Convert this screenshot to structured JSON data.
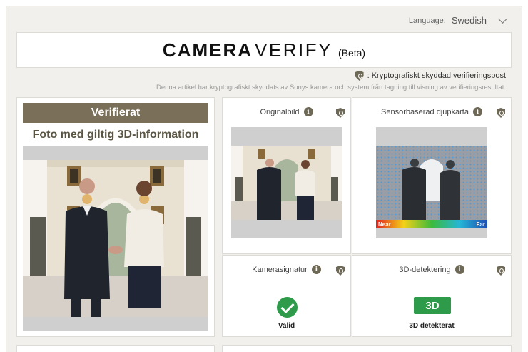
{
  "language": {
    "label": "Language:",
    "value": "Swedish"
  },
  "logo": {
    "bold": "CAMERA",
    "thin": "VERIFY",
    "suffix": "(Beta)"
  },
  "legend_text": ": Kryptografiskt skyddad verifieringspost",
  "description": "Denna artikel har kryptografiskt skyddats av Sonys kamera och system från tagning till visning av verifieringsresultat.",
  "main": {
    "status": "Verifierat",
    "subtitle": "Foto med giltig 3D-information"
  },
  "panels": {
    "original": {
      "title": "Originalbild"
    },
    "depth": {
      "title": "Sensorbaserad djupkarta",
      "near": "Near",
      "far": "Far"
    },
    "signature": {
      "title": "Kamerasignatur",
      "result": "Valid"
    },
    "detection": {
      "title": "3D-detektering",
      "badge": "3D",
      "result": "3D detekterat"
    }
  },
  "colors": {
    "accent": "#7a6f58",
    "success": "#2e9b4b",
    "background": "#f1f0ec"
  }
}
